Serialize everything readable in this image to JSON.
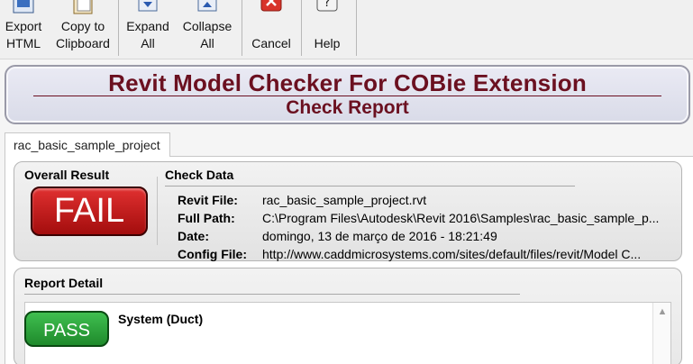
{
  "toolbar": {
    "export_html": "Export\nHTML",
    "copy_clipboard": "Copy to\nClipboard",
    "expand_all": "Expand\nAll",
    "collapse_all": "Collapse\nAll",
    "cancel": "Cancel",
    "help": "Help"
  },
  "banner": {
    "title": "Revit Model Checker For COBie Extension",
    "subtitle": "Check Report"
  },
  "tab": {
    "label": "rac_basic_sample_project"
  },
  "summary": {
    "overall_label": "Overall Result",
    "result": "FAIL",
    "check_data_label": "Check Data",
    "revit_file_key": "Revit File:",
    "revit_file_value": "rac_basic_sample_project.rvt",
    "full_path_key": "Full Path:",
    "full_path_value": "C:\\Program Files\\Autodesk\\Revit 2016\\Samples\\rac_basic_sample_p...",
    "date_key": "Date:",
    "date_value": "domingo, 13 de março de 2016 - 18:21:49",
    "config_file_key": "Config File:",
    "config_file_value": "http://www.caddmicrosystems.com/sites/default/files/revit/Model C..."
  },
  "detail": {
    "label": "Report Detail",
    "items": [
      {
        "status": "PASS",
        "title": "System (Duct)"
      }
    ]
  },
  "colors": {
    "brand_red": "#6b1020",
    "fail_red": "#c41a1a",
    "pass_green": "#2aa23a"
  }
}
